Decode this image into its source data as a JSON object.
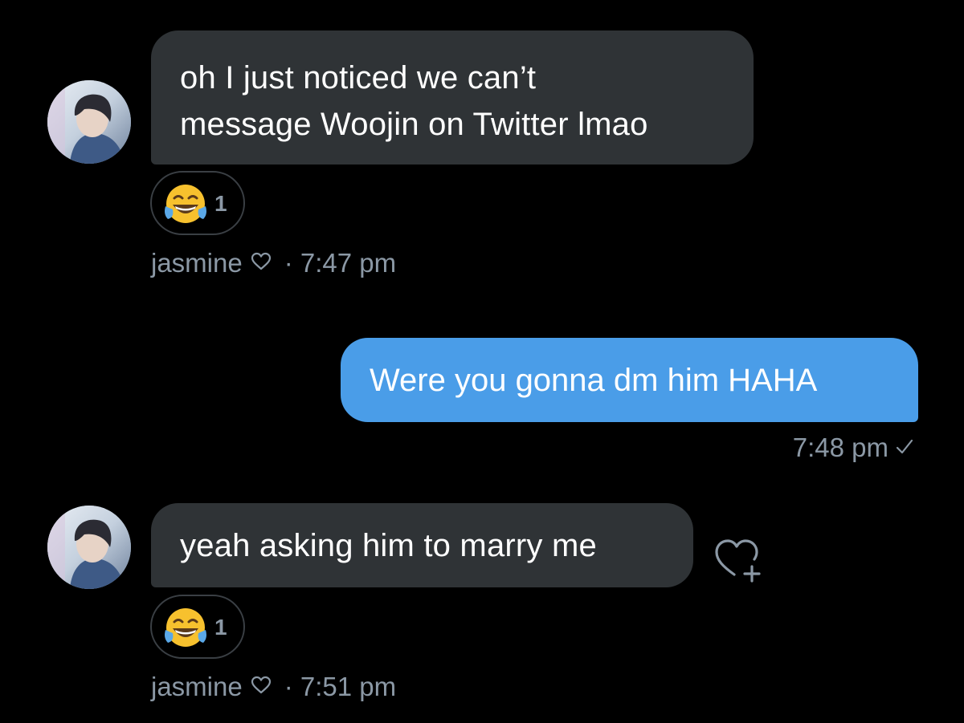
{
  "thread": {
    "messages": [
      {
        "direction": "received",
        "lines": [
          "oh I just noticed we can’t",
          "message Woojin on Twitter lmao"
        ],
        "reaction": {
          "emoji": "face-with-tears-of-joy",
          "count": "1"
        },
        "sender": "jasmine",
        "time": "· 7:47 pm"
      },
      {
        "direction": "sent",
        "lines": [
          "Were you gonna dm him HAHA"
        ],
        "time": "7:48 pm"
      },
      {
        "direction": "received",
        "lines": [
          "yeah asking him to marry me"
        ],
        "reaction": {
          "emoji": "face-with-tears-of-joy",
          "count": "1"
        },
        "sender": "jasmine",
        "time": "· 7:51 pm"
      }
    ]
  },
  "colors": {
    "background": "#000000",
    "received_bubble": "#2f3336",
    "sent_bubble": "#4a9de8",
    "meta_text": "#8b98a5"
  },
  "icons": {
    "heart": "heart-outline-icon",
    "check": "checkmark-icon",
    "add_reaction": "heart-plus-icon"
  }
}
